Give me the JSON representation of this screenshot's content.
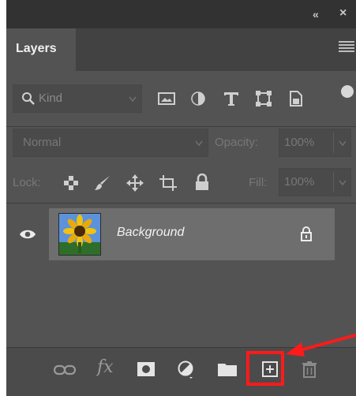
{
  "panel": {
    "titlebar": {
      "collapse_glyph": "«",
      "close_glyph": "×"
    },
    "tab_label": "Layers",
    "menu_icon": "hamburger-menu-icon"
  },
  "filter_row": {
    "kind_label": "Kind",
    "filters": [
      "image-filter-icon",
      "adjustment-filter-icon",
      "type-filter-icon",
      "shape-filter-icon",
      "smart-object-filter-icon"
    ]
  },
  "blend_row": {
    "blend_mode": "Normal",
    "opacity_label": "Opacity:",
    "opacity_value": "100%"
  },
  "lock_row": {
    "lock_label": "Lock:",
    "fill_label": "Fill:",
    "fill_value": "100%"
  },
  "layers": [
    {
      "name": "Background",
      "visible": true,
      "locked": true
    }
  ],
  "bottom_bar": {
    "buttons": [
      "link-icon",
      "fx-icon",
      "layer-mask-icon",
      "adjustment-layer-icon",
      "new-group-icon",
      "new-layer-icon",
      "delete-layer-icon"
    ],
    "fx_label": "fx",
    "highlighted_button": "new-layer-icon",
    "highlight_color": "#ff1a1a"
  }
}
